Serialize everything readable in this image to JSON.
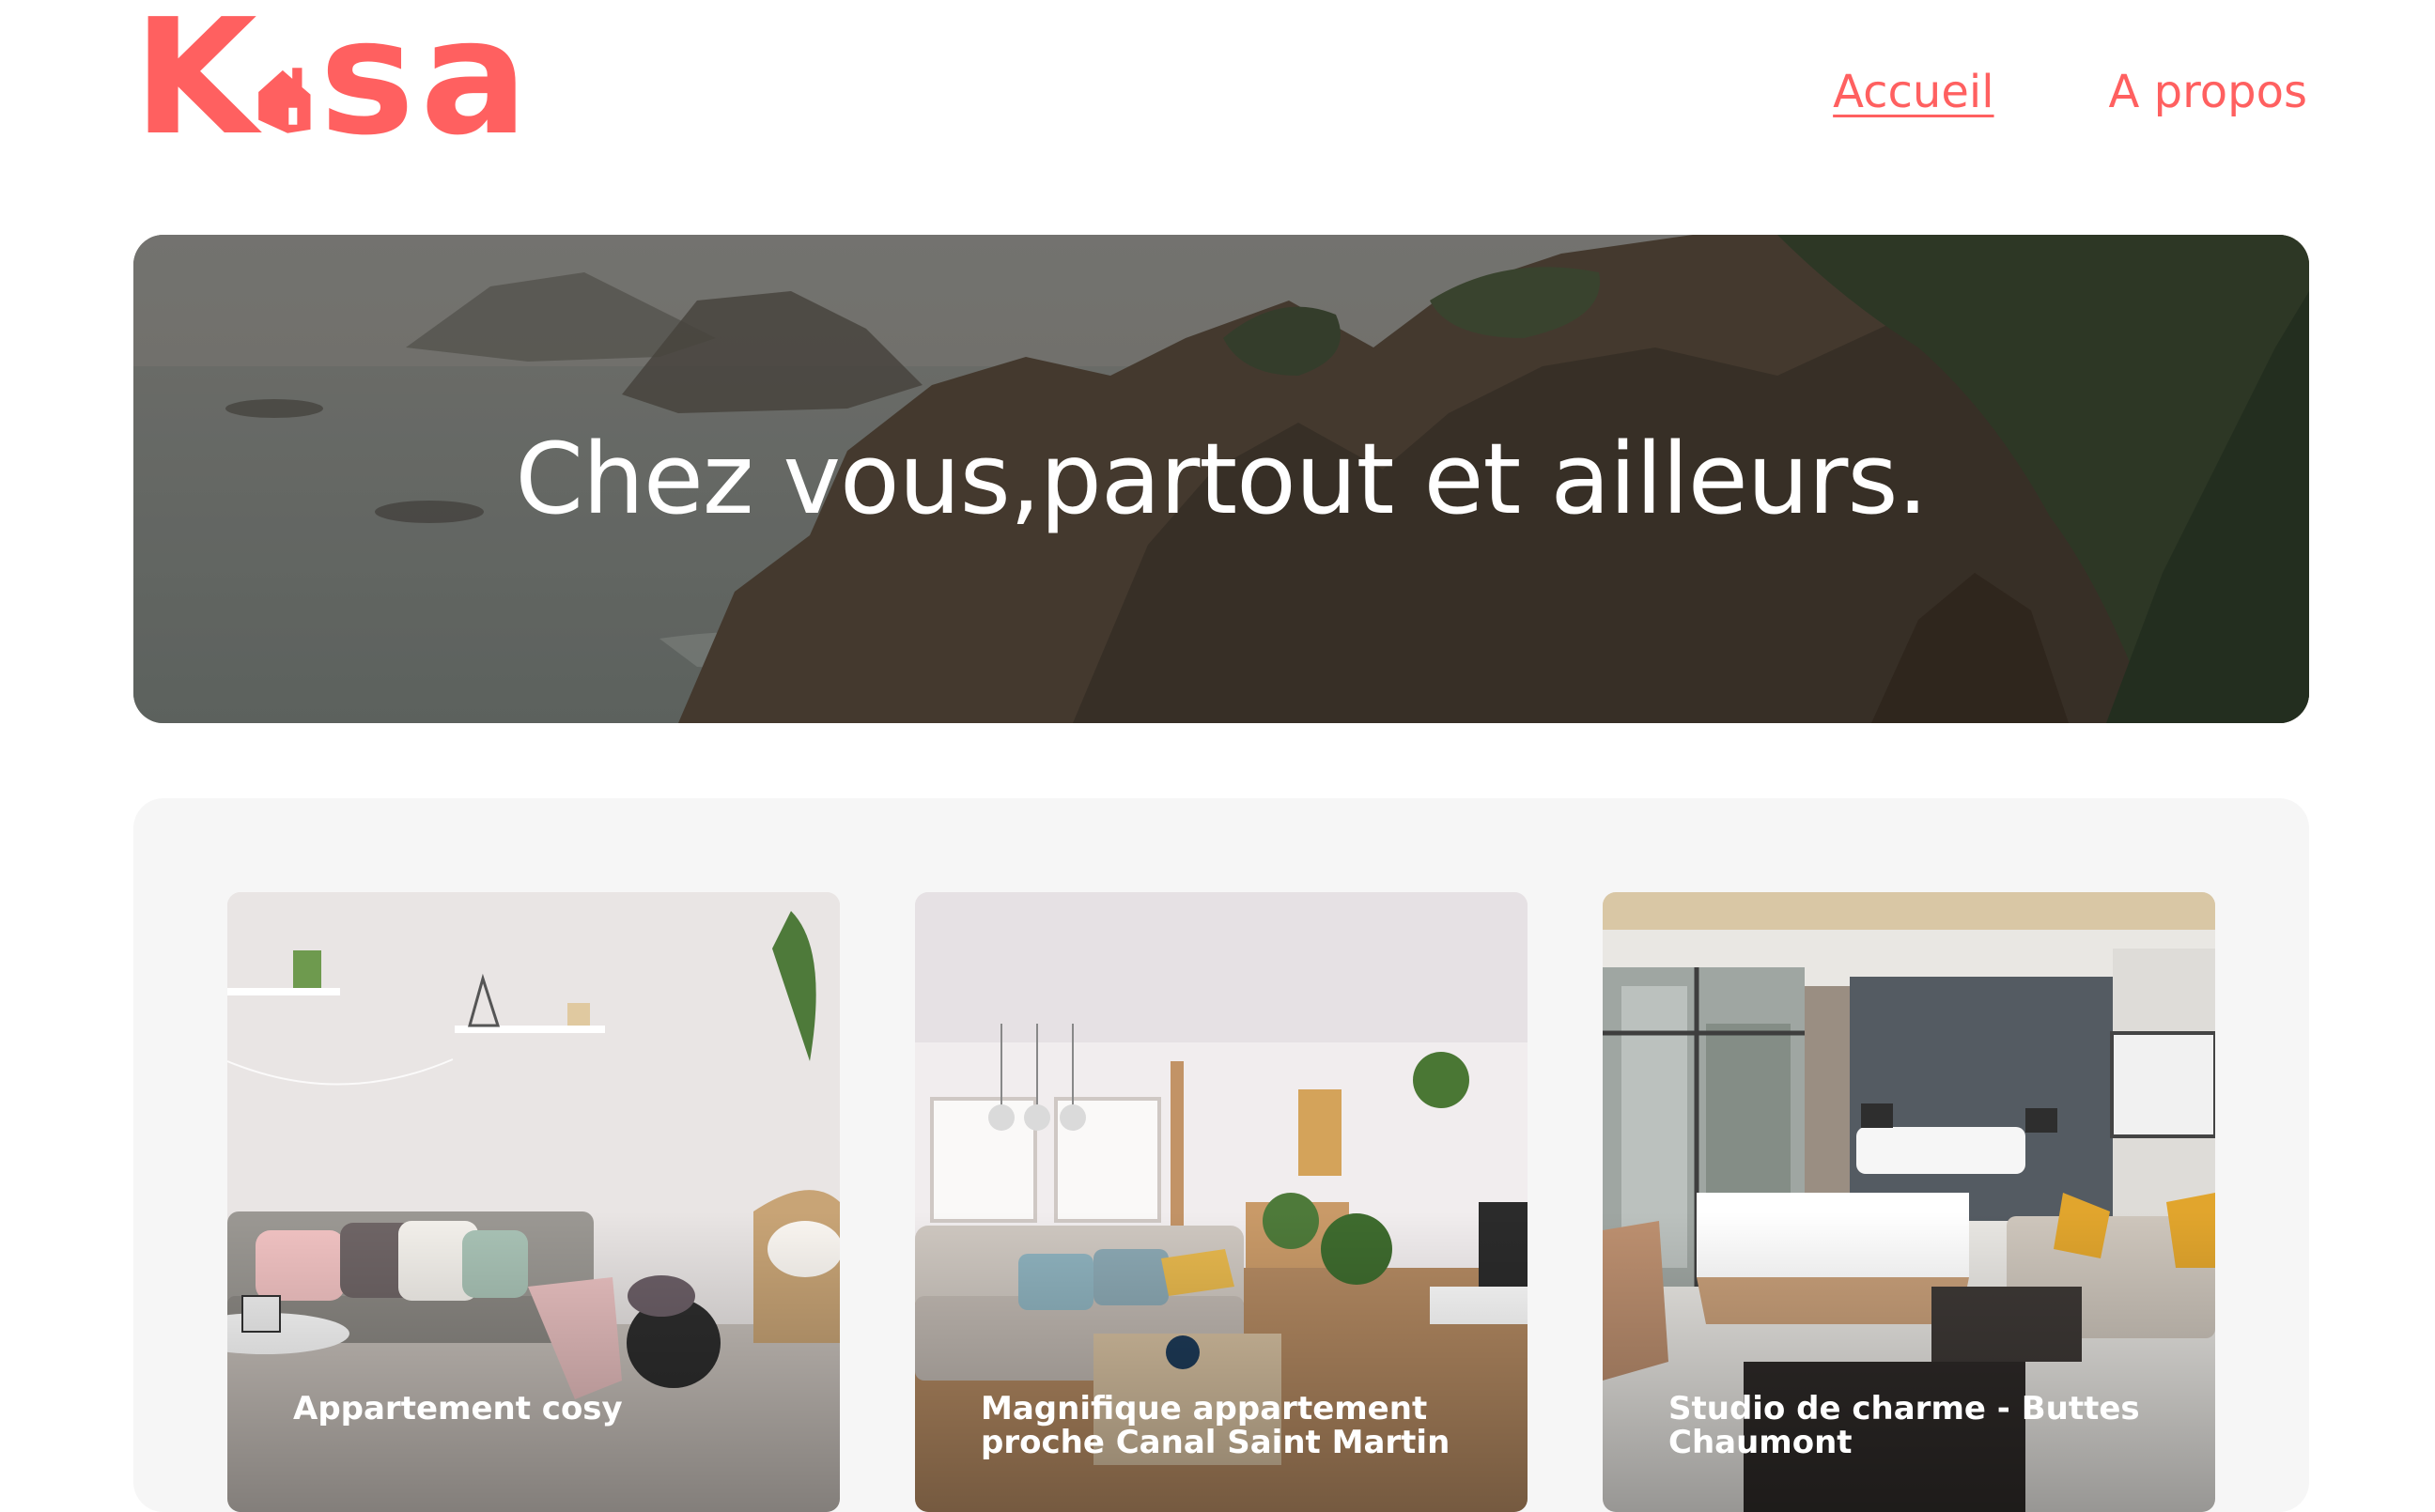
{
  "brand": {
    "logo_start": "K",
    "logo_end": "sa",
    "color": "#FF6060"
  },
  "nav": {
    "items": [
      {
        "label": "Accueil",
        "active": true
      },
      {
        "label": "A propos",
        "active": false
      }
    ]
  },
  "banner": {
    "title": "Chez vous,partout et ailleurs."
  },
  "gallery": {
    "background": "#F6F6F6",
    "cards": [
      {
        "title": "Appartement cosy"
      },
      {
        "title": "Magnifique appartement proche Canal Saint Martin"
      },
      {
        "title": "Studio de charme - Buttes Chaumont"
      }
    ]
  }
}
